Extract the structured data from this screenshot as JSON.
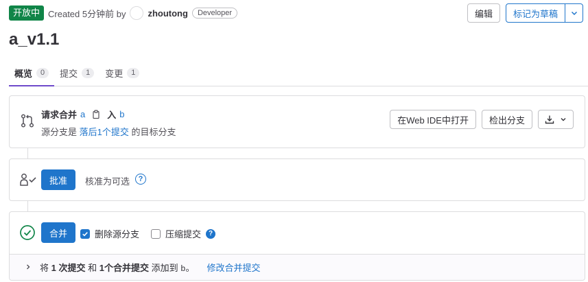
{
  "header": {
    "status": "开放中",
    "created_prefix": "Created 5分钟前 by",
    "author": "zhoutong",
    "role": "Developer",
    "edit_label": "编辑",
    "draft_label": "标记为草稿"
  },
  "title": "a_v1.1",
  "tabs": [
    {
      "label": "概览",
      "count": "0"
    },
    {
      "label": "提交",
      "count": "1"
    },
    {
      "label": "变更",
      "count": "1"
    }
  ],
  "merge_request": {
    "heading": "请求合并",
    "source_branch": "a",
    "into": "入",
    "target_branch": "b",
    "info_prefix": "源分支是",
    "info_link": "落后1个提交",
    "info_suffix": "的目标分支",
    "open_ide_label": "在Web IDE中打开",
    "checkout_label": "检出分支"
  },
  "approval": {
    "approve_label": "批准",
    "optional_text": "核准为可选"
  },
  "merge": {
    "merge_label": "合并",
    "delete_source_label": "删除源分支",
    "delete_source_checked": true,
    "squash_label": "压缩提交",
    "squash_checked": false,
    "footer": {
      "part1": "将",
      "commits": "1 次提交",
      "part2": "和",
      "merge_commits": "1个合并提交",
      "part3": "添加到",
      "branch": "b",
      "part4": "。",
      "modify_link": "修改合并提交"
    }
  },
  "colors": {
    "status_green": "#108548",
    "primary_blue": "#1f75cb",
    "active_tab_underline": "#6e49cb",
    "success_check": "#108548"
  }
}
